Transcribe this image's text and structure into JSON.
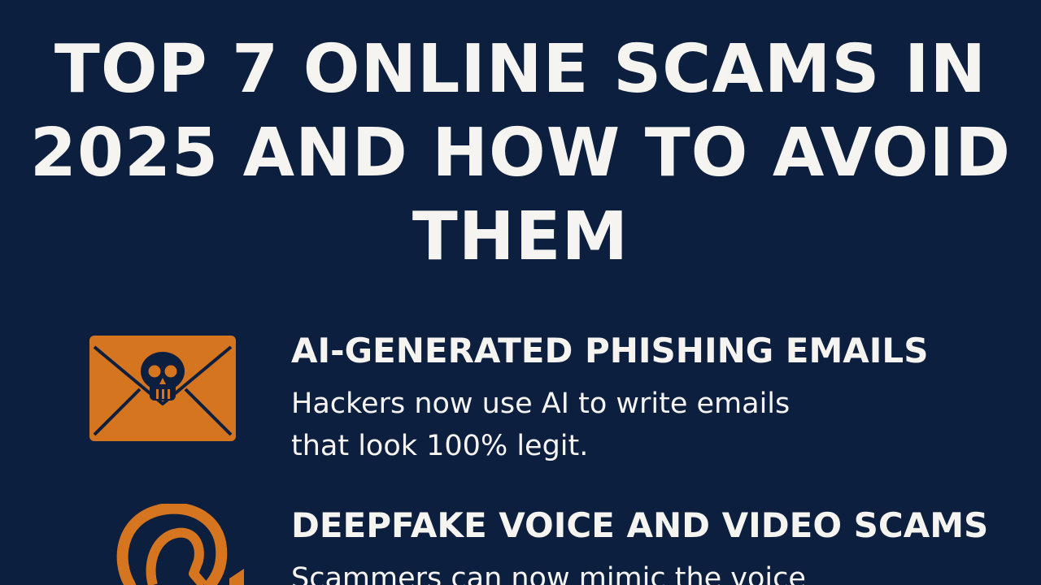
{
  "title": {
    "lines": [
      "TOP 7 ONLINE SCAMS IN",
      "2025 AND HOW TO AVOID",
      "THEM"
    ]
  },
  "items": [
    {
      "icon": "phishing-envelope-icon",
      "heading": "AI-GENERATED PHISHING EMAILS",
      "desc_lines": [
        "Hackers now use AI to write emails",
        "that look 100% legit."
      ]
    },
    {
      "icon": "deepfake-voice-icon",
      "heading": "DEEPFAKE VOICE AND VIDEO SCAMS",
      "desc_lines": [
        "Scammers can now mimic the voice"
      ]
    }
  ],
  "colors": {
    "background": "#0d1f3f",
    "accent": "#d5751f",
    "text": "#f6f4f0"
  }
}
